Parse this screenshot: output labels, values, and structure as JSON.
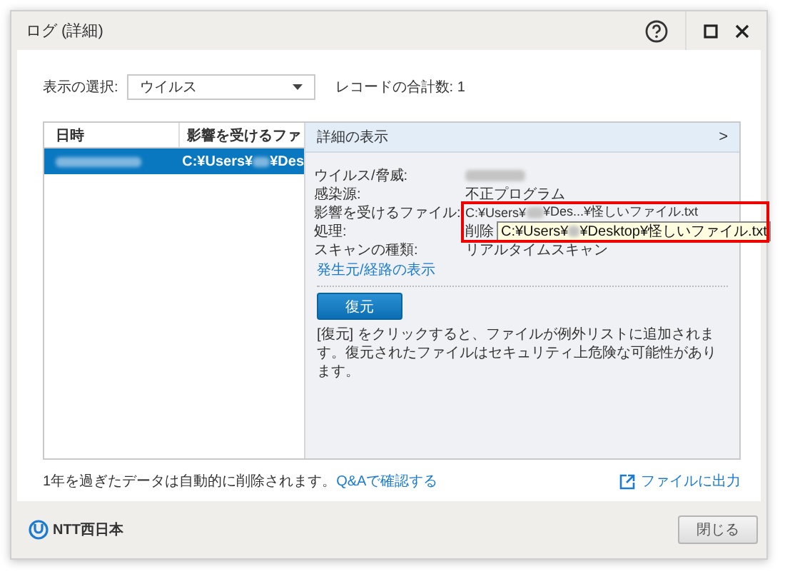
{
  "window": {
    "title": "ログ (詳細)"
  },
  "filter": {
    "label": "表示の選択:",
    "value": "ウイルス",
    "record_count": "レコードの合計数: 1"
  },
  "table": {
    "columns": [
      "日時",
      "影響を受けるファ"
    ],
    "rows": [
      {
        "selected": true,
        "path_start": "C:¥Users¥",
        "path_end": "¥Des"
      }
    ]
  },
  "detail": {
    "header": "詳細の表示",
    "chevron": ">",
    "fields": [
      {
        "label": "ウイルス/脅威:",
        "kind": "redacted"
      },
      {
        "label": "感染源:",
        "kind": "text",
        "value": "不正プログラム"
      },
      {
        "label": "影響を受けるファイル:",
        "kind": "path",
        "path_start": "C:¥Users¥",
        "path_end": "¥Des...¥怪しいファイル.txt"
      },
      {
        "label": "処理:",
        "kind": "text",
        "value": "削除"
      },
      {
        "label": "スキャンの種類:",
        "kind": "text",
        "value": "リアルタイムスキャン"
      }
    ],
    "tooltip": {
      "path_start": "C:¥Users¥",
      "path_end": "¥Desktop¥怪しいファイル.txt"
    },
    "source_link": "発生元/経路の表示",
    "restore_button": "復元",
    "note": "[復元] をクリックすると、ファイルが例外リストに追加されます。復元されたファイルはセキュリティ上危険な可能性があります。"
  },
  "footnote": {
    "text": "1年を過ぎたデータは自動的に削除されます。",
    "link": "Q&Aで確認する"
  },
  "export_link": "ファイルに出力",
  "footer": {
    "logo": "NTT西日本",
    "close_button": "閉じる"
  }
}
